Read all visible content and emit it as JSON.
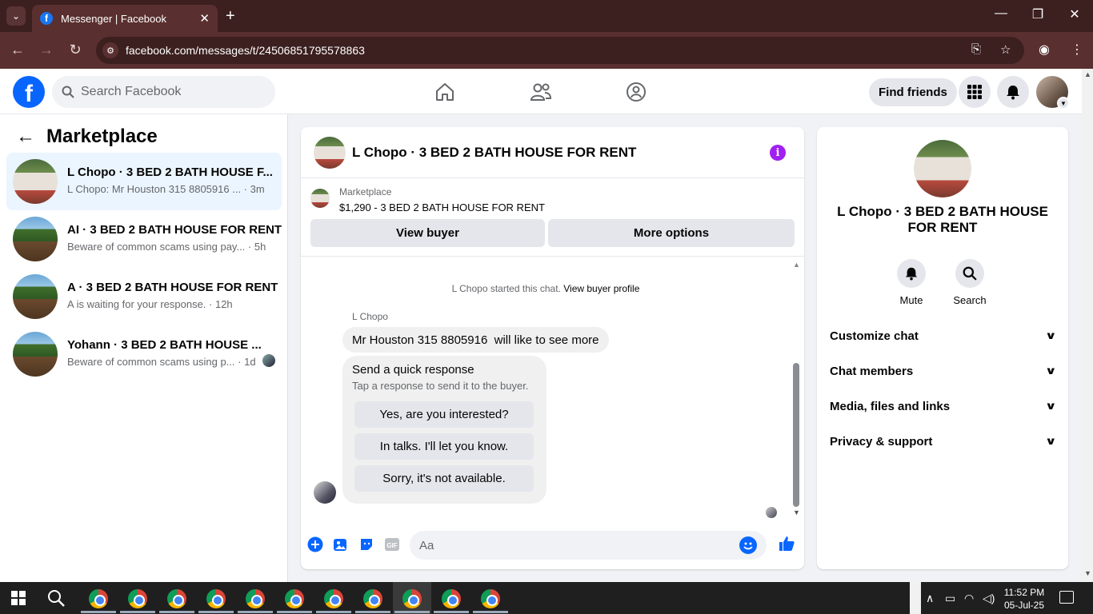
{
  "browser": {
    "tab_title": "Messenger | Facebook",
    "url": "facebook.com/messages/t/24506851795578863"
  },
  "fb": {
    "search_placeholder": "Search Facebook",
    "find_friends": "Find friends"
  },
  "sidebar": {
    "title": "Marketplace",
    "conversations": [
      {
        "title": "L Chopo · 3 BED 2 BATH HOUSE F...",
        "preview": "L Chopo: Mr Houston 315 8805916 ... · 3m",
        "active": true
      },
      {
        "title": "AI · 3 BED 2 BATH HOUSE FOR RENT",
        "preview": "Beware of common scams using pay... · 5h"
      },
      {
        "title": "A · 3 BED 2 BATH HOUSE FOR RENT",
        "preview": "A is waiting for your response. · 12h"
      },
      {
        "title": "Yohann · 3 BED 2 BATH HOUSE ...",
        "preview": "Beware of common scams using p... · 1d"
      }
    ]
  },
  "chat": {
    "title": "L Chopo · 3 BED 2 BATH HOUSE FOR RENT",
    "listing_source": "Marketplace",
    "listing_price": "$1,290 - 3 BED 2 BATH HOUSE FOR RENT",
    "view_buyer": "View buyer",
    "more_options": "More options",
    "started_text": "L Chopo started this chat.",
    "view_buyer_profile": "View buyer profile",
    "sender_name": "L Chopo",
    "message": "Mr Houston 315 8805916  will like to see more",
    "quick_response_title": "Send a quick response",
    "quick_response_sub": "Tap a response to send it to the buyer.",
    "quick_responses": [
      "Yes, are you interested?",
      "In talks. I'll let you know.",
      "Sorry, it's not available."
    ],
    "composer_placeholder": "Aa"
  },
  "info": {
    "name": "L Chopo · 3 BED 2 BATH HOUSE FOR RENT",
    "mute": "Mute",
    "search": "Search",
    "sections": [
      "Customize chat",
      "Chat members",
      "Media, files and links",
      "Privacy & support"
    ]
  },
  "taskbar": {
    "time": "11:52 PM",
    "date": "05-Jul-25"
  },
  "colors": {
    "brand": "#0866ff",
    "chrome_frame": "#3c1f1f",
    "active_conversation": "#ebf5ff",
    "info_icon": "#a020f0"
  }
}
